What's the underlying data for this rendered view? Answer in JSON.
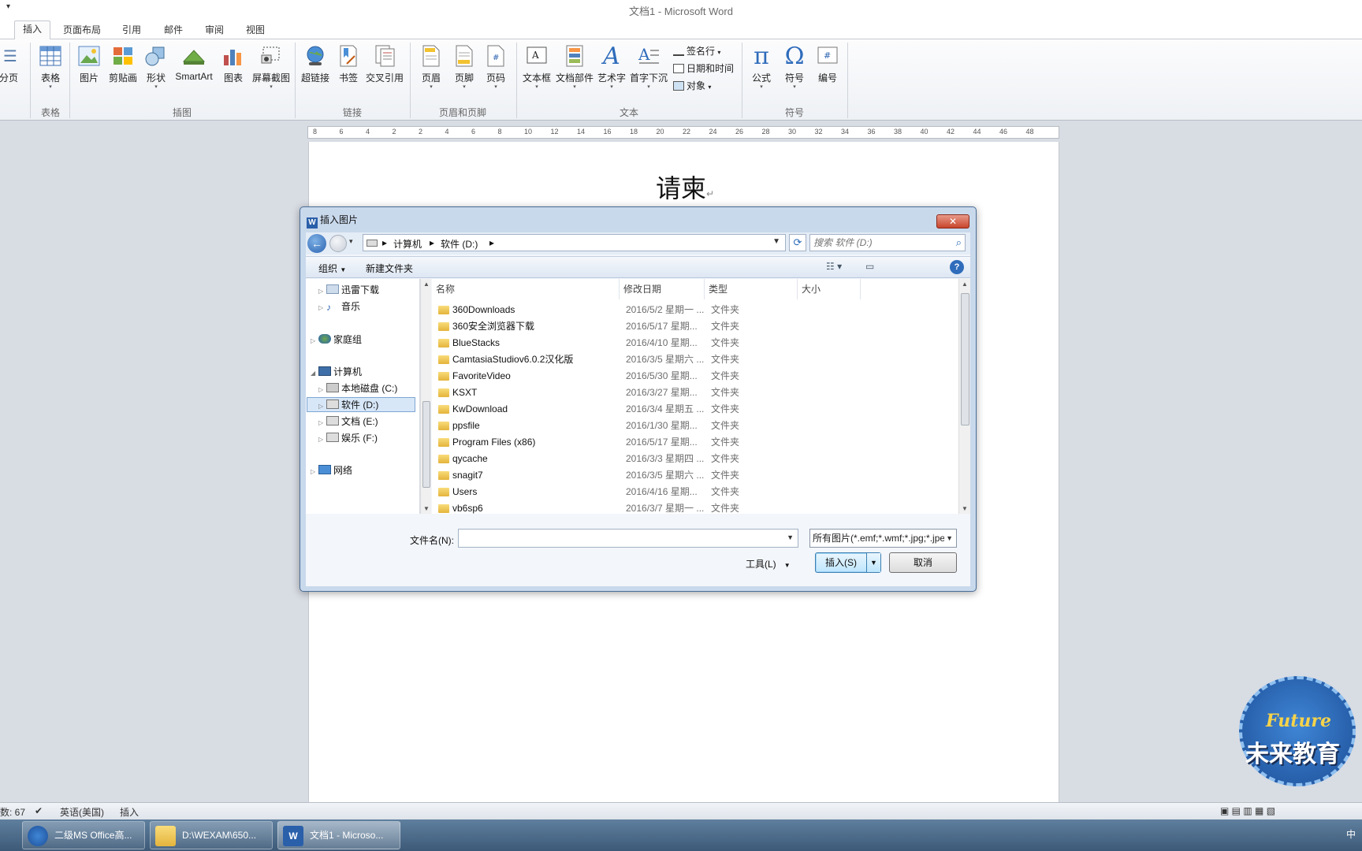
{
  "window": {
    "title": "文档1 - Microsoft Word",
    "qat_glyph": "▾"
  },
  "tabs": [
    "插入",
    "页面布局",
    "引用",
    "邮件",
    "审阅",
    "视图"
  ],
  "ribbon": {
    "pagebreak": "分页",
    "table": "表格",
    "illustrations": [
      "图片",
      "剪贴画",
      "形状",
      "SmartArt",
      "图表",
      "屏幕截图"
    ],
    "links": [
      "超链接",
      "书签",
      "交叉引用"
    ],
    "headerfooter": [
      "页眉",
      "页脚",
      "页码"
    ],
    "text": [
      "文本框",
      "文档部件",
      "艺术字",
      "首字下沉"
    ],
    "text_small": [
      "签名行",
      "日期和时间",
      "对象"
    ],
    "symbols": [
      "公式",
      "符号",
      "编号"
    ],
    "groups": [
      "表格",
      "插图",
      "链接",
      "页眉和页脚",
      "文本",
      "符号"
    ]
  },
  "ruler_ticks": [
    "8",
    "6",
    "4",
    "2",
    "2",
    "4",
    "6",
    "8",
    "10",
    "12",
    "14",
    "16",
    "18",
    "20",
    "22",
    "24",
    "26",
    "28",
    "30",
    "32",
    "34",
    "36",
    "38",
    "40",
    "42",
    "44",
    "46",
    "48"
  ],
  "document": {
    "heading": "请柬",
    "para_mark": "↵"
  },
  "dialog": {
    "title": "插入图片",
    "crumbs": [
      "计算机",
      "软件 (D:)"
    ],
    "search_placeholder": "搜索 软件 (D:)",
    "organize": "组织",
    "new_folder": "新建文件夹",
    "nav": [
      {
        "label": "迅雷下载"
      },
      {
        "label": "音乐"
      },
      {
        "label": "家庭组"
      },
      {
        "label": "计算机"
      },
      {
        "label": "本地磁盘 (C:)"
      },
      {
        "label": "软件 (D:)"
      },
      {
        "label": "文档 (E:)"
      },
      {
        "label": "娱乐 (F:)"
      },
      {
        "label": "网络"
      }
    ],
    "columns": [
      "名称",
      "修改日期",
      "类型",
      "大小"
    ],
    "files": [
      {
        "name": "360Downloads",
        "date": "2016/5/2 星期一 ...",
        "type": "文件夹"
      },
      {
        "name": "360安全浏览器下载",
        "date": "2016/5/17 星期...",
        "type": "文件夹"
      },
      {
        "name": "BlueStacks",
        "date": "2016/4/10 星期...",
        "type": "文件夹"
      },
      {
        "name": "CamtasiaStudiov6.0.2汉化版",
        "date": "2016/3/5 星期六 ...",
        "type": "文件夹"
      },
      {
        "name": "FavoriteVideo",
        "date": "2016/5/30 星期...",
        "type": "文件夹"
      },
      {
        "name": "KSXT",
        "date": "2016/3/27 星期...",
        "type": "文件夹"
      },
      {
        "name": "KwDownload",
        "date": "2016/3/4 星期五 ...",
        "type": "文件夹"
      },
      {
        "name": "ppsfile",
        "date": "2016/1/30 星期...",
        "type": "文件夹"
      },
      {
        "name": "Program Files (x86)",
        "date": "2016/5/17 星期...",
        "type": "文件夹"
      },
      {
        "name": "qycache",
        "date": "2016/3/3 星期四 ...",
        "type": "文件夹"
      },
      {
        "name": "snagit7",
        "date": "2016/3/5 星期六 ...",
        "type": "文件夹"
      },
      {
        "name": "Users",
        "date": "2016/4/16 星期...",
        "type": "文件夹"
      },
      {
        "name": "vb6sp6",
        "date": "2016/3/7 星期一 ...",
        "type": "文件夹"
      }
    ],
    "filename_label": "文件名(N):",
    "filename_value": "",
    "filetype": "所有图片(*.emf;*.wmf;*.jpg;*.jpeg",
    "tools": "工具(L)",
    "insert": "插入(S)",
    "cancel": "取消",
    "close": "✕"
  },
  "status": {
    "words": "数: 67",
    "lang": "英语(美国)",
    "mode": "插入"
  },
  "taskbar": [
    {
      "label": "二级MS Office高..."
    },
    {
      "label": "D:\\WEXAM\\650..."
    },
    {
      "label": "文档1 - Microso..."
    }
  ],
  "tray": {
    "text": "中"
  },
  "watermark": {
    "en": "Future",
    "cn": "未来教育"
  },
  "colors": {
    "accent": "#2a62b0",
    "dialog_frame": "#c9d9ec",
    "close": "#c8452c"
  }
}
